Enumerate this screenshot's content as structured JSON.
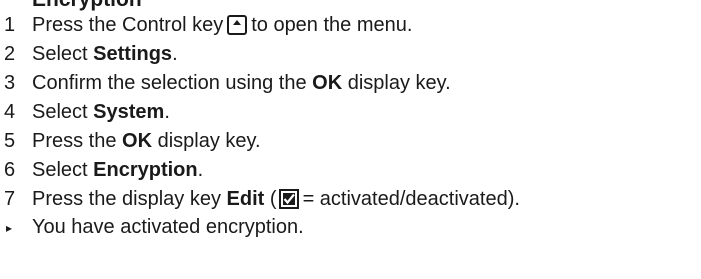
{
  "heading": "Encryption",
  "steps": [
    {
      "num": "1",
      "before": "Press the Control key",
      "after": "to open the menu.",
      "icon": "control-key-icon"
    },
    {
      "num": "2",
      "before": "Select",
      "bold": "Settings",
      "after": "."
    },
    {
      "num": "3",
      "before": "Confirm the selection using the",
      "bold": "OK",
      "after": "display key."
    },
    {
      "num": "4",
      "before": "Select",
      "bold": "System",
      "after": "."
    },
    {
      "num": "5",
      "before": "Press the",
      "bold": "OK",
      "after": "display key."
    },
    {
      "num": "6",
      "before": "Select",
      "bold": "Encryption",
      "after": "."
    },
    {
      "num": "7",
      "before": "Press the display key",
      "bold": "Edit",
      "paren_open": "(",
      "after": "= activated/deactivated).",
      "icon": "checkbox-checked-icon"
    }
  ],
  "result": {
    "marker": "▸",
    "text": "You have activated encryption."
  }
}
